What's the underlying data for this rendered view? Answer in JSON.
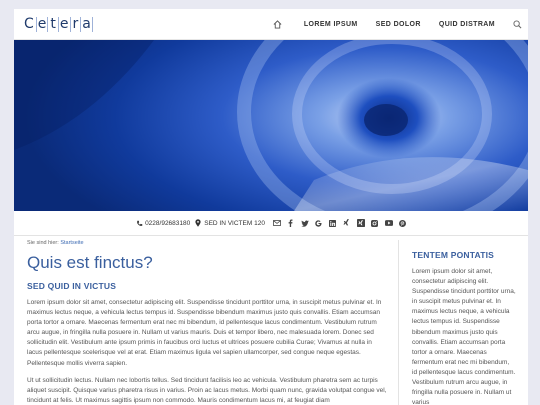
{
  "logo": {
    "letters": [
      "C",
      "e",
      "t",
      "e",
      "r",
      "a"
    ]
  },
  "nav": {
    "items": [
      "LOREM IPSUM",
      "SED DOLOR",
      "QUID DISTRAM"
    ]
  },
  "contact": {
    "phone": "0228/92683180",
    "address": "SED IN VICTEM 120"
  },
  "breadcrumb": {
    "prefix": "Sie sind hier:",
    "link": "Startseite"
  },
  "main": {
    "title": "Quis est finctus?",
    "subtitle": "SED QUID IN VICTUS",
    "paragraph1": "Lorem ipsum dolor sit amet, consectetur adipiscing elit. Suspendisse tincidunt porttitor urna, in suscipit metus pulvinar et. In maximus lectus neque, a vehicula lectus tempus id. Suspendisse bibendum maximus justo quis convallis. Etiam accumsan porta tortor a ornare. Maecenas fermentum erat nec mi bibendum, id pellentesque lacus condimentum. Vestibulum rutrum arcu augue, in fringilla nulla posuere in. Nullam ut varius mauris. Duis et tempor libero, nec malesuada lorem. Donec sed sollicitudin elit. Vestibulum ante ipsum primis in faucibus orci luctus et ultrices posuere cubilia Curae; Vivamus at nulla in lacus pellentesque scelerisque vel at erat. Etiam maximus ligula vel sapien ullamcorper, sed congue neque egestas. Pellentesque mollis viverra sapien.",
    "paragraph2": "Ut ut sollicitudin lectus. Nullam nec lobortis tellus. Sed tincidunt facilisis leo ac vehicula. Vestibulum pharetra sem ac turpis aliquet suscipit. Quisque varius pharetra risus in varius. Proin ac lacus metus. Morbi quam nunc, gravida volutpat congue vel, tincidunt at felis. Ut maximus sagittis ipsum non commodo. Mauris condimentum lacus mi, at feugiat diam"
  },
  "sidebar": {
    "title": "TENTEM PONTATIS",
    "text": "Lorem ipsum dolor sit amet, consectetur adipiscing elit. Suspendisse tincidunt porttitor urna, in suscipit metus pulvinar et. In maximus lectus neque, a vehicula lectus tempus id. Suspendisse bibendum maximus justo quis convallis. Etiam accumsan porta tortor a ornare. Maecenas fermentum erat nec mi bibendum, id pellentesque lacus condimentum. Vestibulum rutrum arcu augue, in fringilla nulla posuere in. Nullam ut varius"
  },
  "icons": {
    "home": "home-icon",
    "search": "search-icon",
    "phone": "phone-icon",
    "location": "location-pin-icon",
    "mail": "mail-icon",
    "social": [
      "facebook-icon",
      "twitter-icon",
      "google-plus-icon",
      "linkedin-icon",
      "xing-icon",
      "xing-alt-icon",
      "instagram-icon",
      "youtube-icon",
      "pinterest-icon"
    ]
  },
  "colors": {
    "accent": "#3a5f9e",
    "logo": "#1f3a6b",
    "background": "#e8e9f2"
  }
}
